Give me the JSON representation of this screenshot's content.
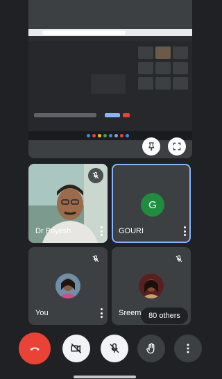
{
  "participants": [
    {
      "name": "Dr Priyesh",
      "muted": true
    },
    {
      "name": "GOURI",
      "muted": false,
      "initial": "G",
      "active_speaker": true
    },
    {
      "name": "You",
      "muted": true
    },
    {
      "name": "Sreem",
      "muted": true
    }
  ],
  "overflow": {
    "label": "80 others"
  },
  "colors": {
    "background": "#202124",
    "tile": "#3c4043",
    "active_border": "#8ab4f8",
    "avatar_g": "#1e8e3e",
    "end_call": "#ea4335"
  },
  "presentation": {
    "actions": [
      "pin-icon",
      "fullscreen-icon"
    ]
  },
  "controls": [
    "end-call",
    "camera-off",
    "mic-off",
    "raise-hand",
    "more-options"
  ]
}
